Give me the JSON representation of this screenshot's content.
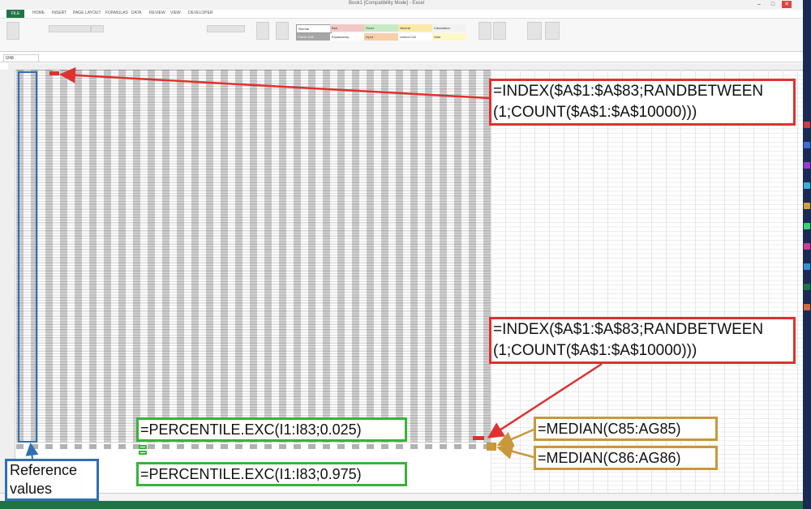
{
  "window": {
    "title": "Book1 [Compatibility Mode] - Excel",
    "file_tab": "FILE",
    "tabs": [
      "HOME",
      "INSERT",
      "PAGE LAYOUT",
      "FORMULAS",
      "DATA",
      "REVIEW",
      "VIEW",
      "DEVELOPER"
    ],
    "namebox": "I248"
  },
  "ribbon": {
    "styles": [
      {
        "label": "Normal",
        "color": "#ffffff"
      },
      {
        "label": "Bad",
        "color": "#f4c7c7"
      },
      {
        "label": "Good",
        "color": "#c9eac9"
      },
      {
        "label": "Neutral",
        "color": "#fbe9a8"
      },
      {
        "label": "Calculation",
        "color": "#f2f2f2"
      },
      {
        "label": "Check Cell",
        "color": "#a5a5a5"
      },
      {
        "label": "Explanatory...",
        "color": "#ffffff"
      },
      {
        "label": "Input",
        "color": "#f8cfa8"
      },
      {
        "label": "Linked Cell",
        "color": "#ffffff"
      },
      {
        "label": "Note",
        "color": "#fff8c8"
      }
    ]
  },
  "annotations": {
    "formula_top": "=INDEX($A$1:$A$83;RANDBETWEEN (1;COUNT($A$1:$A$10000)))",
    "formula_mid": "=INDEX($A$1:$A$83;RANDBETWEEN (1;COUNT($A$1:$A$10000)))",
    "percentile_low": "=PERCENTILE.EXC(I1:I83;0.025)",
    "percentile_high": "=PERCENTILE.EXC(I1:I83;0.975)",
    "median_85": "=MEDIAN(C85:AG85)",
    "median_86": "=MEDIAN(C86:AG86)",
    "reference": "Reference values"
  },
  "colors": {
    "excel_green": "#217346",
    "arrow_red": "#e03030",
    "percentile_green": "#3ab23a",
    "median_gold": "#c8983a",
    "reference_blue": "#2f6fb5"
  }
}
